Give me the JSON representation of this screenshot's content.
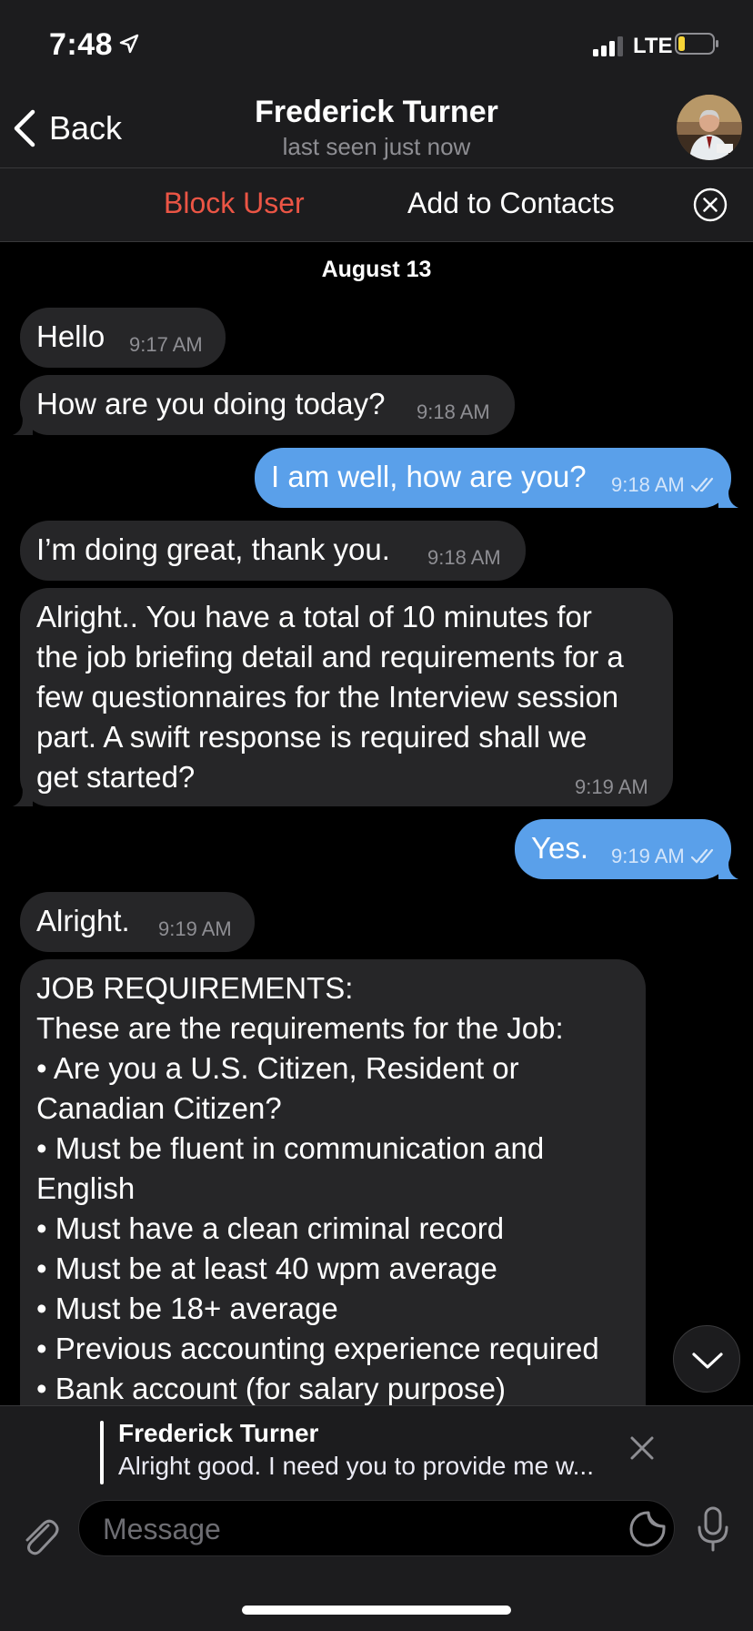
{
  "status_bar": {
    "time": "7:48",
    "network": "LTE",
    "icons": [
      "location-arrow-icon",
      "signal-bars-icon",
      "battery-icon"
    ]
  },
  "header": {
    "back_label": "Back",
    "contact_name": "Frederick Turner",
    "last_seen": "last seen just now",
    "avatar": "avatar-photo"
  },
  "actions": {
    "block_label": "Block User",
    "add_contact_label": "Add to Contacts"
  },
  "chat": {
    "date": "August 13",
    "messages": [
      {
        "dir": "in",
        "text": "Hello",
        "time": "9:17 AM"
      },
      {
        "dir": "in",
        "text": "How are you doing today?",
        "time": "9:18 AM"
      },
      {
        "dir": "out",
        "text": "I am well, how are you?",
        "time": "9:18 AM",
        "read": true
      },
      {
        "dir": "in",
        "text": "I’m doing great, thank you.",
        "time": "9:18 AM"
      },
      {
        "dir": "in",
        "lines": [
          "Alright.. You have a total of 10 minutes for",
          "the job briefing detail and requirements for a",
          "few questionnaires for the Interview session",
          "part. A swift response is required shall we",
          "get started?"
        ],
        "time": "9:19 AM"
      },
      {
        "dir": "out",
        "text": "Yes.",
        "time": "9:19 AM",
        "read": true
      },
      {
        "dir": "in",
        "text": "Alright.",
        "time": "9:19 AM"
      },
      {
        "dir": "in",
        "lines": [
          "JOB REQUIREMENTS:",
          "These are the requirements for the Job:",
          "• Are you a U.S. Citizen, Resident or",
          "Canadian Citizen?",
          "• Must be fluent in communication and",
          "English",
          "• Must have a clean criminal record",
          "• Must be at least 40 wpm average",
          "• Must be 18+ average",
          "• Previous accounting experience required",
          "• Bank account (for salary purpose)"
        ]
      }
    ]
  },
  "reply": {
    "name": "Frederick Turner",
    "text": "Alright good. I need you to provide me w..."
  },
  "composer": {
    "placeholder": "Message"
  },
  "colors": {
    "accent_out": "#5aa0ea",
    "bubble_in": "#262628",
    "block_red": "#eb5545",
    "bar_bg": "#1c1c1e"
  }
}
